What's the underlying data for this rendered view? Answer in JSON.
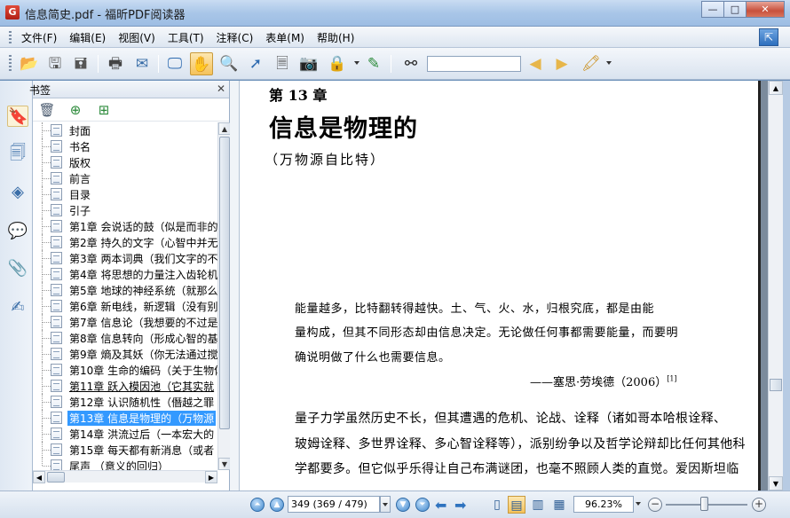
{
  "window": {
    "title": "信息简史.pdf - 福昕PDF阅读器",
    "minimize": "—",
    "maximize": "□",
    "close": "✕"
  },
  "menu": [
    "文件(F)",
    "编辑(E)",
    "视图(V)",
    "工具(T)",
    "注释(C)",
    "表单(M)",
    "帮助(H)"
  ],
  "toolbar": {
    "search_value": "",
    "icons": [
      "open-folder-icon",
      "save-icon",
      "save-all-icon",
      "print-icon",
      "email-icon",
      "fullscreen-icon",
      "hand-tool-icon",
      "zoom-tool-icon",
      "select-tool-icon",
      "text-select-icon",
      "snapshot-icon",
      "rms-lock-icon",
      "sign-icon",
      "find-binoculars-icon",
      "find-prev-icon",
      "find-next-icon",
      "highlight-icon"
    ]
  },
  "bookmark_panel": {
    "header": "书签",
    "close": "✕",
    "items": [
      "封面",
      "书名",
      "版权",
      "前言",
      "目录",
      "引子",
      "第1章  会说话的鼓（似是而非的",
      "第2章  持久的文字（心智中并无",
      "第3章  两本词典（我们文字的不",
      "第4章  将思想的力量注入齿轮机",
      "第5章  地球的神经系统（就那么",
      "第6章  新电线，新逻辑（没有别",
      "第7章  信息论（我想要的不过是",
      "第8章  信息转向（形成心智的基",
      "第9章  熵及其妖（你无法通过搅",
      "第10章  生命的编码（关于生物体",
      "第11章  跃入模因池（它其实就",
      "第12章  认识随机性（僭越之罪",
      "第13章  信息是物理的（万物源",
      "第14章  洪流过后（一本宏大的",
      "第15章  每天都有新消息（或者",
      "尾声  （意义的回归）"
    ],
    "selected_index": 18,
    "underlined_index": 16
  },
  "page": {
    "chapter_number": "第 13 章",
    "chapter_title": "信息是物理的",
    "chapter_subtitle": "（万物源自比特）",
    "epigraph_lines": [
      "能量越多，比特翻转得越快。土、气、火、水，归根究底，都是由能",
      "量构成，但其不同形态却由信息决定。无论做任何事都需要能量，而要明",
      "确说明做了什么也需要信息。"
    ],
    "epigraph_attribution": "——塞思·劳埃德（2006）",
    "epigraph_ref": "[1]",
    "body_lines": [
      "量子力学虽然历史不长，但其遭遇的危机、论战、诠释（诸如哥本哈根诠释、",
      "玻姆诠释、多世界诠释、多心智诠释等），派别纷争以及哲学论辩却比任何其他科",
      "学都要多。但它似乎乐得让自己布满谜团，也毫不照顾人类的直觉。爱因斯坦临"
    ]
  },
  "statusbar": {
    "page_field": "349 (369 / 479)",
    "zoom_field": "96.23%",
    "zoom_out": "−",
    "zoom_in": "+"
  }
}
